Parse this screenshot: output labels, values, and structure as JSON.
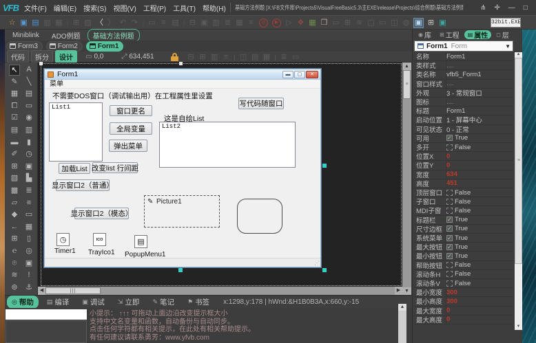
{
  "window": {
    "logo": "VFB",
    "menus": [
      "文件(F)",
      "编辑(E)",
      "搜索(S)",
      "视图(V)",
      "工程(P)",
      "工具(T)",
      "帮助(H)"
    ],
    "doc_title": "基础方法例题 [X:\\FB文件库\\Projects5\\VisualFreeBasic5.3\\主EXE\\release\\Projects\\综合例题\\基础方法例题\\基础...",
    "exe_label": "32bit.EXE"
  },
  "project_tabs": {
    "items": [
      "Miniblink",
      "ADO例题",
      "基础方法例题"
    ],
    "active": 2
  },
  "form_tabs": {
    "items": [
      "Form3",
      "Form2",
      "Form1"
    ],
    "active": 2
  },
  "mode_row": {
    "buttons": [
      "代码",
      "拆分",
      "设计"
    ],
    "active": 2,
    "pos": "0,0",
    "size": "634,451"
  },
  "designer_form": {
    "title": "Form1",
    "menu": "菜单",
    "hint_label": "不需要DOS窗口（调试输出用）在工程属性里设置",
    "list1": "List1",
    "list2_label": "这是自绘List",
    "list2": "List2",
    "btn_rename": "窗口更名",
    "btn_globals": "全局变量",
    "btn_popup": "弹出菜单",
    "btn_code_follow": "写代码随窗口",
    "btn_load_list": "加载List",
    "btn_line_spacing": "改变list 行间距",
    "btn_show2_normal": "显示窗口2（普通）",
    "btn_show2_modal": "显示窗口2（模态）",
    "picture": "Picture1",
    "timer": "Timer1",
    "trayico": "TrayIco1",
    "trayico_glyph": "ICO",
    "popupmenu": "PopupMenu1"
  },
  "right_panel": {
    "tabs": [
      "库",
      "工程",
      "属性",
      "层"
    ],
    "active_tab": 2,
    "selector": {
      "name": "Form1",
      "type": "Form"
    },
    "rows": [
      {
        "label": "名称",
        "value": "Form1",
        "kind": "text"
      },
      {
        "label": "类样式",
        "value": "....",
        "kind": "dots"
      },
      {
        "label": "类名称",
        "value": "vfb5_Form1",
        "kind": "text"
      },
      {
        "label": "窗口样式",
        "value": "....",
        "kind": "dots"
      },
      {
        "label": "外观",
        "value": "3 - 常规窗口",
        "kind": "text"
      },
      {
        "label": "图标",
        "value": "....",
        "kind": "dots"
      },
      {
        "label": "标题",
        "value": "Form1",
        "kind": "text"
      },
      {
        "label": "启动位置",
        "value": "1 - 屏幕中心",
        "kind": "text"
      },
      {
        "label": "可见状态",
        "value": "0 - 正常",
        "kind": "text"
      },
      {
        "label": "可用",
        "value": "True",
        "kind": "check-true"
      },
      {
        "label": "多开",
        "value": "False",
        "kind": "check-false"
      },
      {
        "label": "位置X",
        "value": "0",
        "kind": "red"
      },
      {
        "label": "位置Y",
        "value": "0",
        "kind": "red"
      },
      {
        "label": "宽度",
        "value": "634",
        "kind": "red"
      },
      {
        "label": "高度",
        "value": "451",
        "kind": "red"
      },
      {
        "label": "顶层窗口",
        "value": "False",
        "kind": "check-false"
      },
      {
        "label": "子窗口",
        "value": "False",
        "kind": "check-false"
      },
      {
        "label": "MDI子窗",
        "value": "False",
        "kind": "check-false"
      },
      {
        "label": "标题栏",
        "value": "True",
        "kind": "check-true"
      },
      {
        "label": "尺寸边框",
        "value": "True",
        "kind": "check-true"
      },
      {
        "label": "系统菜单",
        "value": "True",
        "kind": "check-true"
      },
      {
        "label": "最大按钮",
        "value": "True",
        "kind": "check-true"
      },
      {
        "label": "最小按钮",
        "value": "True",
        "kind": "check-true"
      },
      {
        "label": "帮助按钮",
        "value": "False",
        "kind": "check-false"
      },
      {
        "label": "滚动条H",
        "value": "False",
        "kind": "check-false"
      },
      {
        "label": "滚动条V",
        "value": "False",
        "kind": "check-false"
      },
      {
        "label": "最小宽度",
        "value": "300",
        "kind": "red"
      },
      {
        "label": "最小高度",
        "value": "300",
        "kind": "red"
      },
      {
        "label": "最大宽度",
        "value": "0",
        "kind": "red"
      },
      {
        "label": "最大高度",
        "value": "0",
        "kind": "red"
      }
    ]
  },
  "bottom": {
    "tabs": [
      "帮助",
      "编译",
      "调试",
      "立即",
      "笔记",
      "书签"
    ],
    "active_tab": 0,
    "tab_icons": [
      "◎",
      "▤",
      "▣",
      "⇲",
      "✎",
      "⚑"
    ],
    "status": "x:1298,y:178 | hWnd:&H1B0B3A,x:660,y:-15",
    "help_lines": [
      "小提示： ↑↑↑ 可拖动上面边沿改变提示框大小",
      "支持中文名变量和函数，自动备份与自动同步。",
      "点击任何字符都有相关提示，在此处有相关帮助提示。",
      "有任何建议请联系勇芳：www.yfvb.com"
    ]
  },
  "toolbox_rows": [
    [
      "↖",
      "A"
    ],
    [
      "✎",
      "╲"
    ],
    [
      "▦",
      "▤"
    ],
    [
      "⧠",
      "▭"
    ],
    [
      "☑",
      "◉"
    ],
    [
      "▤",
      "▥"
    ],
    [
      "▬",
      "▮"
    ],
    [
      "✐",
      "◷"
    ],
    [
      "⊞",
      "▣"
    ],
    [
      "▧",
      "▙"
    ],
    [
      "▩",
      "≣"
    ],
    [
      "▱",
      "≡"
    ],
    [
      "◆",
      "▭"
    ],
    [
      "←",
      "▦"
    ],
    [
      "⊞",
      "▯"
    ],
    [
      "℮",
      "◎"
    ],
    [
      "⌾",
      "▣"
    ],
    [
      "≋",
      "!"
    ],
    [
      "⊚",
      "⚓"
    ]
  ],
  "toolbar_icons": [
    {
      "g": "☆",
      "c": "#cfa52c",
      "k": "i",
      "n": "favorite-icon"
    },
    {
      "g": "▣",
      "c": "#5b9bd5",
      "k": "i",
      "n": "new-file-icon"
    },
    {
      "g": "▤",
      "c": "#4f93d2",
      "k": "i",
      "n": "open-folder-icon"
    },
    {
      "g": "▥",
      "c": "",
      "k": "dim",
      "n": "save-icon"
    },
    {
      "g": "▦",
      "c": "",
      "k": "dim",
      "n": "save-all-icon"
    },
    {
      "g": "|",
      "c": "",
      "k": "sep",
      "n": "separator"
    },
    {
      "g": "⊞",
      "c": "",
      "k": "dim",
      "n": "copy-icon"
    },
    {
      "g": "▧",
      "c": "",
      "k": "dim",
      "n": "paste-icon"
    },
    {
      "g": "〈",
      "c": "#e0e0e0",
      "k": "i",
      "n": "back-icon"
    },
    {
      "g": "〉",
      "c": "",
      "k": "dim",
      "n": "forward-icon"
    },
    {
      "g": "↶",
      "c": "",
      "k": "dim",
      "n": "undo-icon"
    },
    {
      "g": "↷",
      "c": "",
      "k": "dim",
      "n": "redo-icon"
    },
    {
      "g": "|",
      "c": "",
      "k": "sep",
      "n": "separator"
    },
    {
      "g": "▭",
      "c": "",
      "k": "dim",
      "n": "tool-icon"
    },
    {
      "g": "≡",
      "c": "",
      "k": "dim",
      "n": "tool-icon"
    },
    {
      "g": "▤",
      "c": "",
      "k": "dim",
      "n": "tool-icon"
    },
    {
      "g": "|",
      "c": "",
      "k": "sep",
      "n": "separator"
    },
    {
      "g": "⊟",
      "c": "",
      "k": "dim",
      "n": "tool-icon"
    },
    {
      "g": "▣",
      "c": "",
      "k": "dim",
      "n": "tool-icon"
    },
    {
      "g": "▥",
      "c": "",
      "k": "dim",
      "n": "tool-icon"
    },
    {
      "g": "≣",
      "c": "",
      "k": "dim",
      "n": "tool-icon"
    },
    {
      "g": "▦",
      "c": "",
      "k": "dim",
      "n": "tool-icon"
    },
    {
      "g": "≡",
      "c": "",
      "k": "dim",
      "n": "tool-icon"
    },
    {
      "g": "◎",
      "c": "",
      "k": "circ",
      "n": "compile-run-icon"
    },
    {
      "g": "▶",
      "c": "",
      "k": "circ",
      "n": "run-icon"
    },
    {
      "g": "▷",
      "c": "",
      "k": "dim",
      "n": "run-disabled-icon"
    },
    {
      "g": "❖",
      "c": "#8a4a3a",
      "k": "i",
      "n": "layers-icon"
    },
    {
      "g": "▦",
      "c": "#6d8a4a",
      "k": "i",
      "n": "image-icon"
    },
    {
      "g": "❐",
      "c": "#b0a595",
      "k": "i",
      "n": "window-icon"
    },
    {
      "g": "▭",
      "c": "",
      "k": "dim",
      "n": "tool-icon"
    },
    {
      "g": "⊞",
      "c": "",
      "k": "dim",
      "n": "tool-icon"
    },
    {
      "g": "≋",
      "c": "",
      "k": "dim",
      "n": "tool-icon"
    },
    {
      "g": "▢",
      "c": "",
      "k": "dim",
      "n": "tool-icon"
    },
    {
      "g": "▭",
      "c": "",
      "k": "dim",
      "n": "tool-icon"
    },
    {
      "g": "◫",
      "c": "",
      "k": "dim",
      "n": "tool-icon"
    },
    {
      "g": "◍",
      "c": "",
      "k": "dim",
      "n": "chat-icon"
    },
    {
      "g": "▣",
      "c": "#bcd8ea",
      "k": "boxed",
      "n": "active-window-icon"
    },
    {
      "g": "⊞",
      "c": "#c8c8c8",
      "k": "i",
      "n": "grid-icon"
    },
    {
      "g": "▣",
      "c": "#3aa8a0",
      "k": "i",
      "n": "teal-window-icon"
    }
  ],
  "mode_dim_icons": [
    "⊟",
    "⊞",
    "▥",
    "≡",
    "|",
    "◫",
    "▤",
    "▦",
    "|",
    "≣",
    "▭"
  ]
}
